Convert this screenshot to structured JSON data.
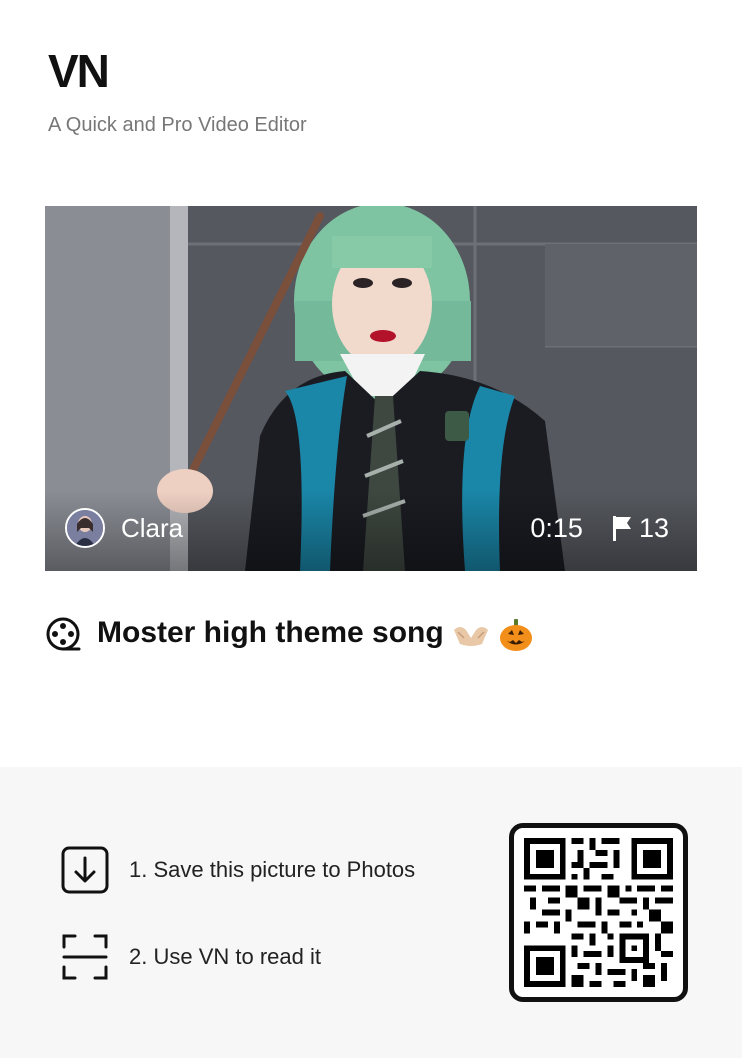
{
  "brand": {
    "logo": "VN",
    "tagline": "A Quick and Pro Video Editor"
  },
  "video": {
    "author": "Clara",
    "duration": "0:15",
    "flag_count": "13",
    "title": "Moster high theme song",
    "title_emojis": [
      "palms-up-together",
      "jack-o-lantern"
    ]
  },
  "steps": [
    {
      "label": "1. Save this picture to Photos",
      "icon": "download-icon"
    },
    {
      "label": "2. Use VN to read it",
      "icon": "scan-icon"
    }
  ],
  "colors": {
    "text": "#111111",
    "muted": "#777777",
    "panel": "#f7f7f7"
  }
}
